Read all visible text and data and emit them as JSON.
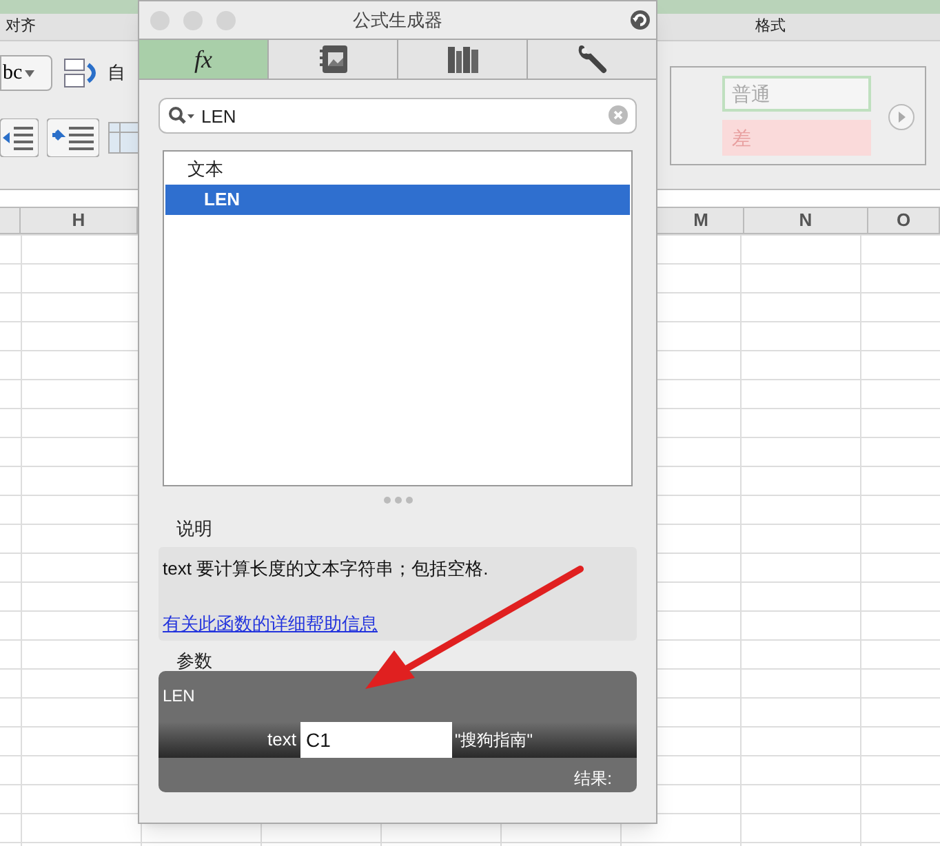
{
  "ribbon": {
    "group_labels": [
      "对齐",
      "格式"
    ],
    "abc_button": "bc",
    "wrap_label": "自",
    "styles": [
      {
        "label": "普通",
        "kind": "normal"
      },
      {
        "label": "差",
        "kind": "bad"
      }
    ]
  },
  "columns_left": [
    "H"
  ],
  "columns_right": [
    "M",
    "N",
    "O"
  ],
  "dialog": {
    "title": "公式生成器",
    "tabs": [
      {
        "kind": "fx",
        "label": "fx",
        "selected": true
      },
      {
        "kind": "gallery",
        "selected": false
      },
      {
        "kind": "books",
        "selected": false
      },
      {
        "kind": "tools",
        "selected": false
      }
    ],
    "search": {
      "value": "LEN"
    },
    "list": [
      {
        "label": "文本",
        "kind": "category",
        "selected": false
      },
      {
        "label": "LEN",
        "kind": "function",
        "selected": true
      }
    ],
    "description": {
      "heading": "说明",
      "text": "text 要计算长度的文本字符串；包括空格.",
      "link": "有关此函数的详细帮助信息"
    },
    "arguments": {
      "heading": "参数",
      "function": "LEN",
      "args": [
        {
          "name": "text",
          "value": "C1",
          "result": "\"搜狗指南\""
        }
      ],
      "result_label": "结果:"
    }
  }
}
